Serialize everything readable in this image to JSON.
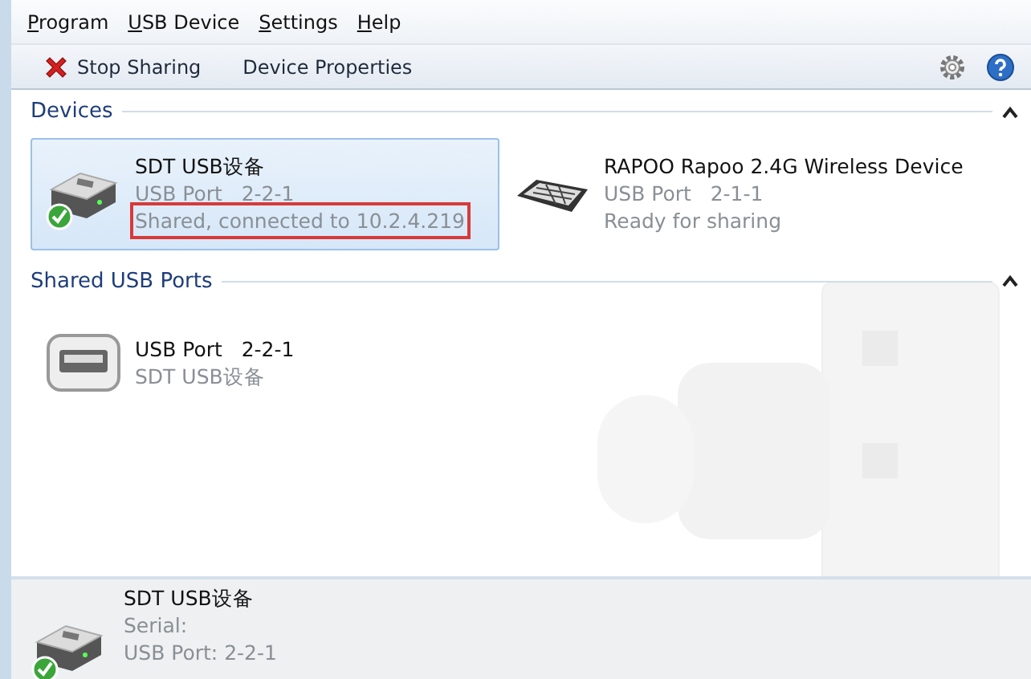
{
  "menu": [
    {
      "label": "Program"
    },
    {
      "label": "USB Device"
    },
    {
      "label": "Settings"
    },
    {
      "label": "Help"
    }
  ],
  "toolbar": [
    {
      "label": "Stop Sharing",
      "kind": "stop"
    },
    {
      "label": "Device Properties",
      "kind": "plain"
    }
  ],
  "groups": [
    {
      "title": "Devices",
      "expanded": true,
      "items": [
        {
          "kind": "drive",
          "title": "SDT USB设备",
          "lines": [
            {
              "text": "USB Port   2-2-1",
              "annotated": false
            },
            {
              "text": "Shared, connected to 10.2.4.219",
              "annotated": true
            }
          ],
          "selected": true,
          "shared": true
        },
        {
          "kind": "receiver",
          "title": "RAPOO Rapoo 2.4G Wireless Device",
          "lines": [
            {
              "text": "USB Port   2-1-1",
              "annotated": false
            },
            {
              "text": "Ready for sharing",
              "annotated": false
            }
          ],
          "selected": false,
          "shared": false
        }
      ]
    },
    {
      "title": "Shared USB Ports",
      "expanded": true,
      "items": [
        {
          "kind": "port",
          "title": "USB Port   2-2-1",
          "lines": [
            {
              "text": "SDT USB设备",
              "annotated": false
            }
          ],
          "selected": false,
          "shared": false
        }
      ]
    }
  ],
  "details": {
    "shared": true,
    "title": "SDT USB设备",
    "lines": [
      "Serial:",
      "USB Port: 2-2-1"
    ]
  }
}
